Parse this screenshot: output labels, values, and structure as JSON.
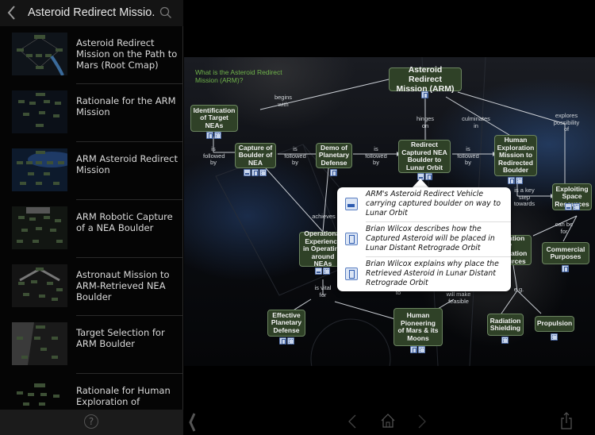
{
  "sidebar": {
    "title": "Asteroid Redirect Missio...",
    "back_icon": "chevron-left-icon",
    "search_icon": "search-icon",
    "help_label": "?",
    "items": [
      {
        "label": "Asteroid Redirect Mission on the Path to Mars (Root Cmap)"
      },
      {
        "label": "Rationale for the ARM Mission"
      },
      {
        "label": "ARM Asteroid Redirect Mission"
      },
      {
        "label": "ARM Robotic Capture of a NEA Boulder"
      },
      {
        "label": "Astronaut Mission to ARM-Retrieved NEA Boulder"
      },
      {
        "label": "Target Selection for ARM Boulder"
      },
      {
        "label": "Rationale for Human Exploration of"
      }
    ]
  },
  "map": {
    "question": "What is the Asteroid Redirect Mission (ARM)?",
    "nodes": {
      "arm": "Asteroid Redirect Mission (ARM)",
      "identification": "Identification of Target NEAs",
      "capture": "Capture of Boulder of NEA",
      "demo": "Demo of Planetary Defense",
      "redirect": "Redirect Captured NEA Boulder to Lunar Orbit",
      "human_exploration": "Human Exploration Mission to Redirected Boulder",
      "exploiting": "Exploiting Space Resources",
      "operational": "Operational Experience in Operating around NEAs",
      "utilization": "Utilization of Exploration Resources",
      "commercial": "Commercial Purposes",
      "effective": "Effective Planetary Defense",
      "pioneering": "Human Pioneering of Mars & its Moons",
      "radiation": "Radiation Shielding",
      "propulsion": "Propulsion"
    },
    "links": {
      "begins_with": "begins with",
      "hinges_on": "hinges on",
      "culminates_in": "culminates in",
      "explores_possibility_of": "explores possibility of",
      "is_followed_by": "is followed by",
      "is_a_key_step_towards": "is a key step towards",
      "achieves": "achieves",
      "is_vital_for": "is vital for",
      "will_make_feasible": "will make feasible",
      "can_be_for": "can be for",
      "eg": "e.g.",
      "to": "to"
    }
  },
  "popover": {
    "items": [
      {
        "icon": "image-icon",
        "text": "ARM's Asteroid Redirect Vehicle carrying captured boulder on way to Lunar Orbit"
      },
      {
        "icon": "video-icon",
        "text": "Brian Wilcox describes how the Captured Asteroid will be placed in Lunar Distant Retrograde Orbit"
      },
      {
        "icon": "video-icon",
        "text": "Brian Wilcox explains why place the Retrieved Asteroid in Lunar Distant Retrograde Orbit"
      }
    ]
  },
  "toolbar": {
    "collapse_icon": "chevron-left-icon",
    "back_icon": "back-arrow-icon",
    "home_icon": "home-icon",
    "forward_icon": "forward-arrow-icon",
    "share_icon": "share-icon"
  }
}
